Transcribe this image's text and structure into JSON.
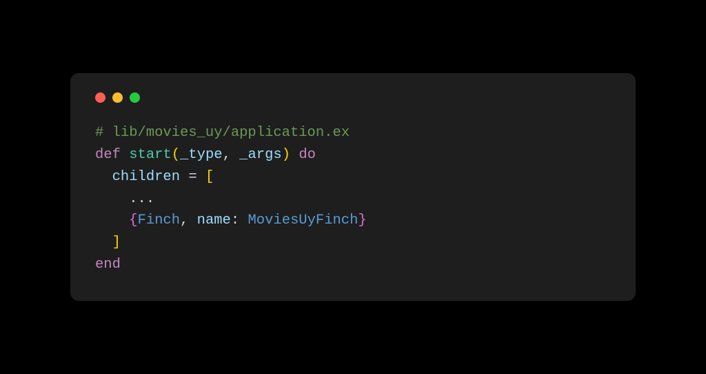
{
  "window": {
    "traffic_lights": {
      "close": "close",
      "minimize": "minimize",
      "zoom": "zoom"
    }
  },
  "code": {
    "line1": {
      "comment": "# lib/movies_uy/application.ex"
    },
    "line2": {
      "kw_def": "def",
      "sp1": " ",
      "fn_name": "start",
      "lparen": "(",
      "arg1": "_type",
      "comma_sp": ", ",
      "arg2": "_args",
      "rparen": ")",
      "sp2": " ",
      "kw_do": "do"
    },
    "line3": {
      "indent": "  ",
      "var": "children",
      "sp1": " ",
      "eq": "=",
      "sp2": " ",
      "lbracket": "["
    },
    "line4": {
      "indent": "    ",
      "dots": "..."
    },
    "line5": {
      "indent": "    ",
      "lbrace": "{",
      "mod1": "Finch",
      "comma_sp": ", ",
      "key": "name",
      "colon_sp": ": ",
      "mod2": "MoviesUyFinch",
      "rbrace": "}"
    },
    "line6": {
      "indent": "  ",
      "rbracket": "]"
    },
    "line7": {
      "kw_end": "end"
    }
  }
}
